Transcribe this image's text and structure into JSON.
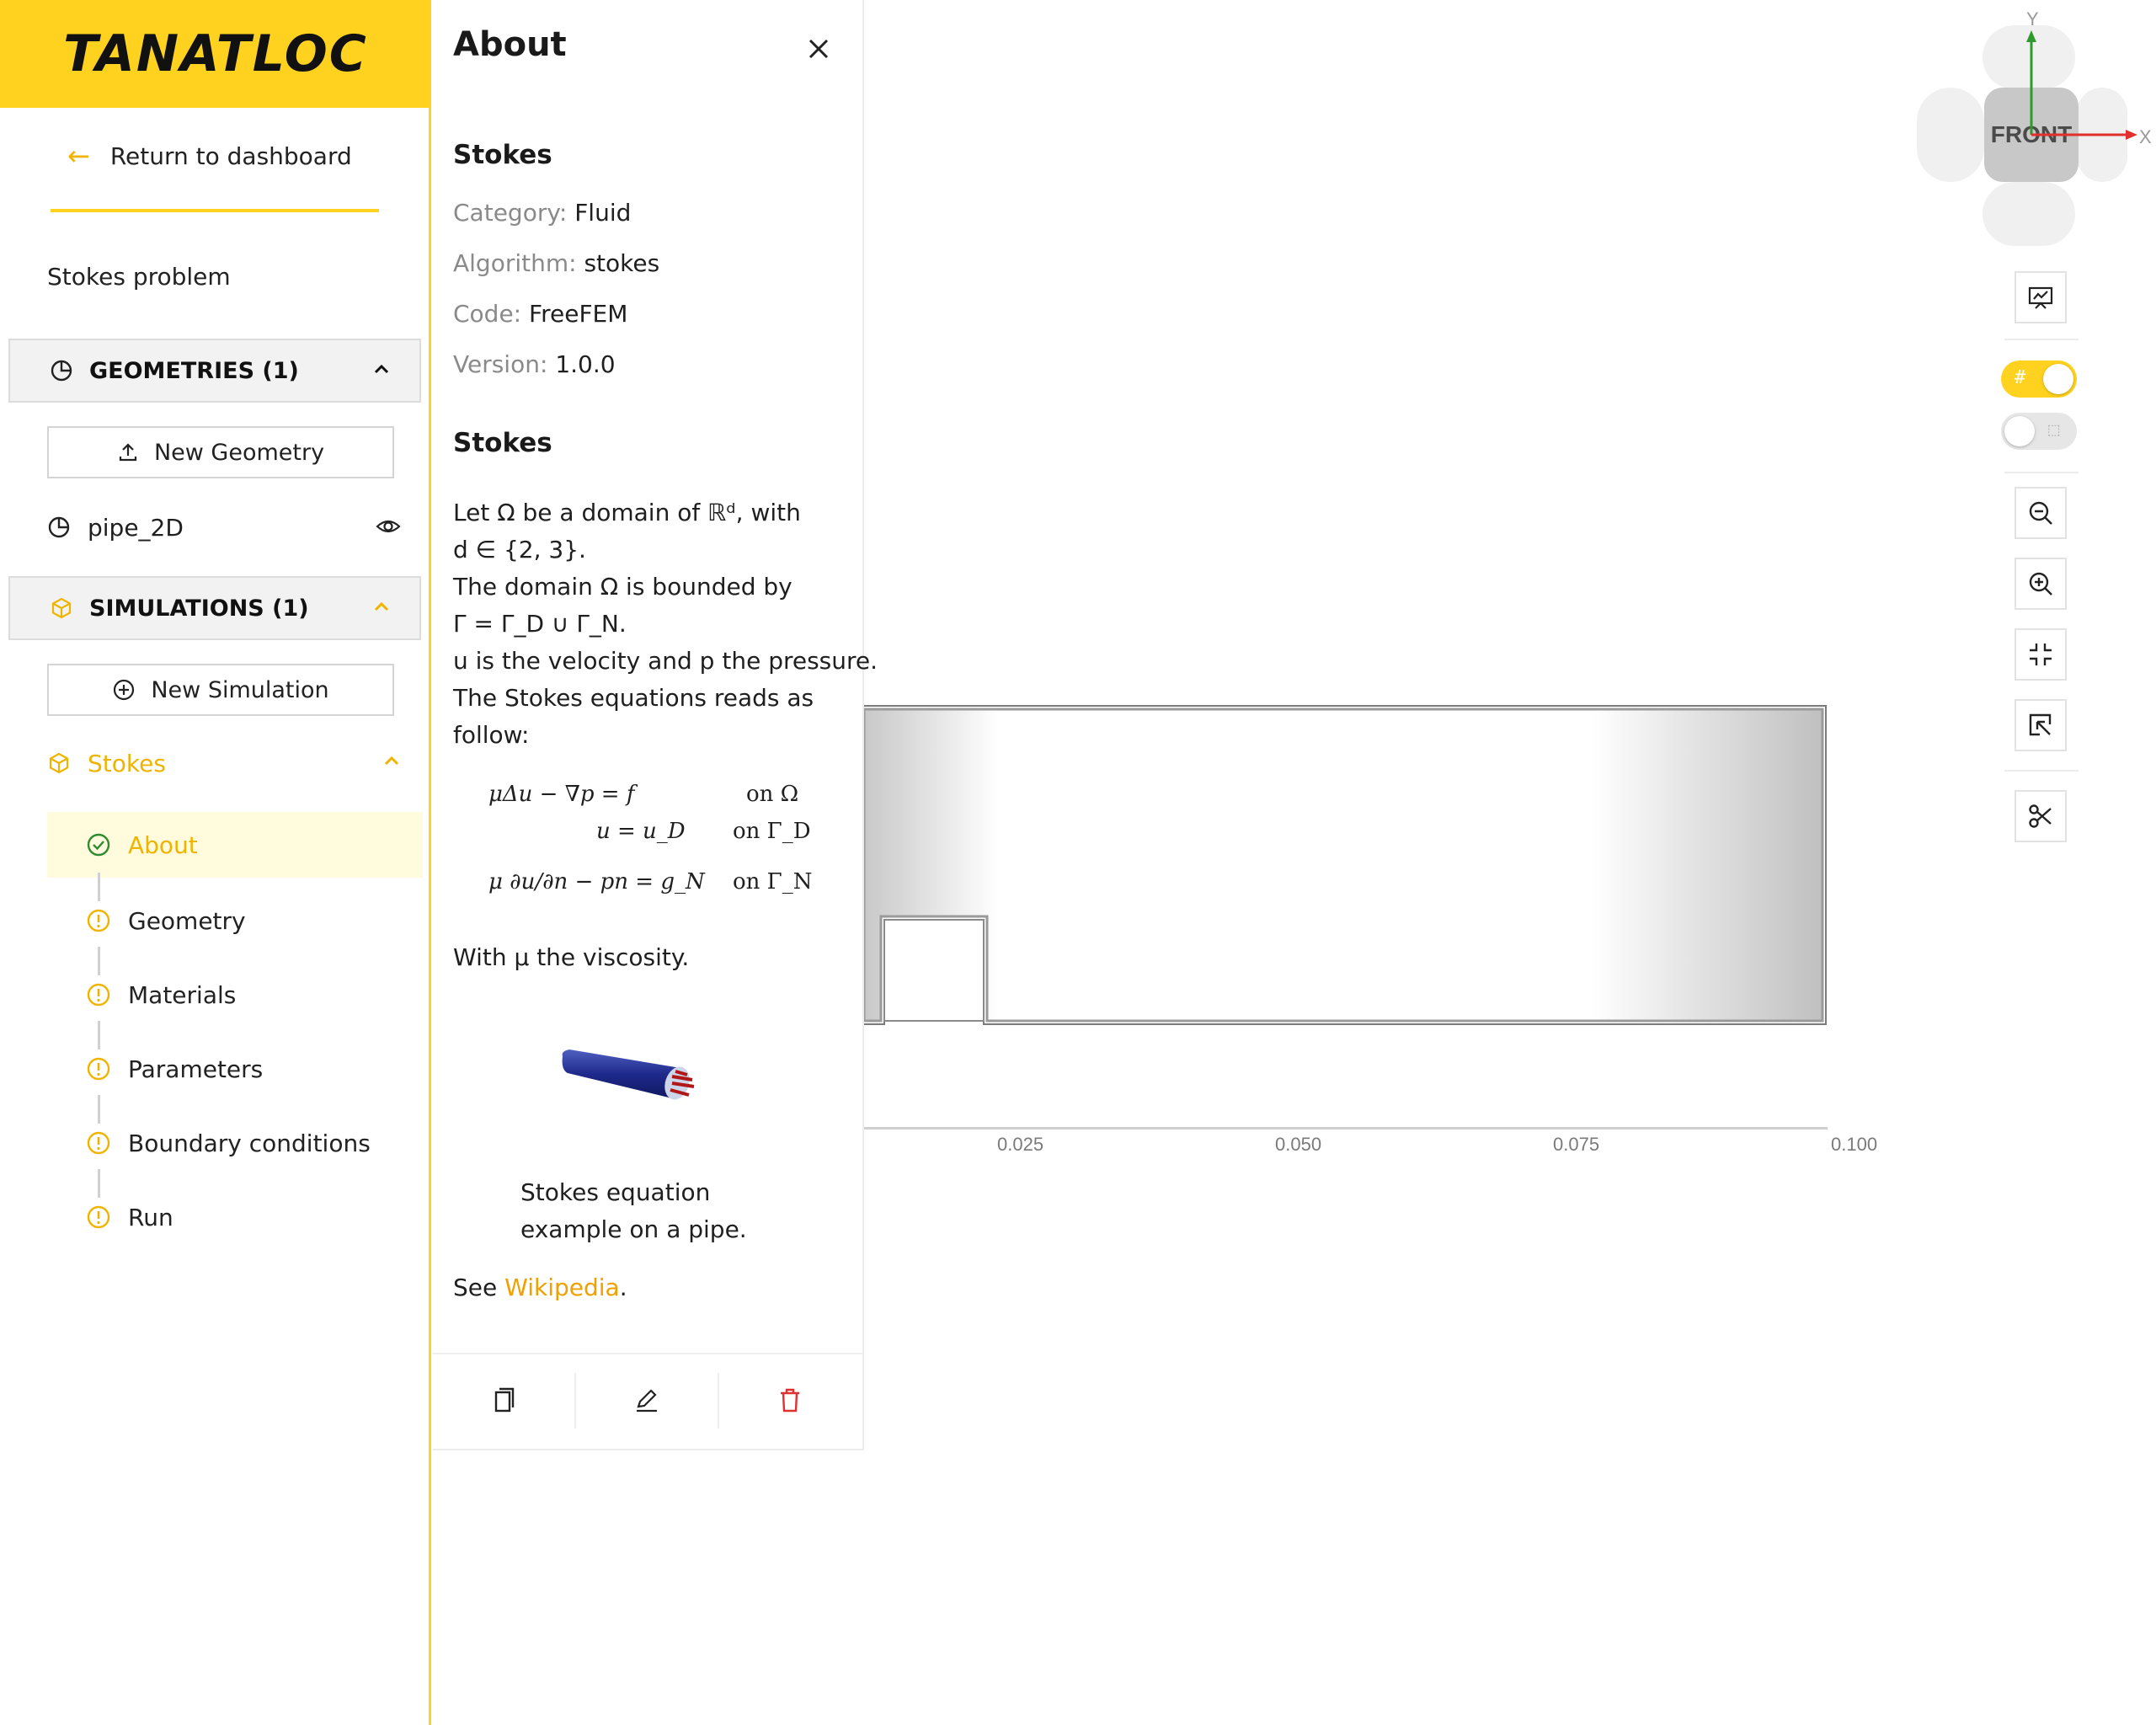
{
  "brand": {
    "logo_text": "TANATLOC",
    "accent_color": "#ffd21f",
    "link_color": "#f0a000"
  },
  "sidebar": {
    "return_label": "Return to dashboard",
    "project_name": "Stokes problem",
    "geometries": {
      "header": "GEOMETRIES (1)",
      "new_button": "New Geometry",
      "items": [
        {
          "label": "pipe_2D"
        }
      ]
    },
    "simulations": {
      "header": "SIMULATIONS (1)",
      "new_button": "New Simulation",
      "items": [
        {
          "label": "Stokes",
          "steps": [
            {
              "label": "About",
              "status": "done",
              "active": true
            },
            {
              "label": "Geometry",
              "status": "warning"
            },
            {
              "label": "Materials",
              "status": "warning"
            },
            {
              "label": "Parameters",
              "status": "warning"
            },
            {
              "label": "Boundary conditions",
              "status": "warning"
            },
            {
              "label": "Run",
              "status": "warning"
            }
          ]
        }
      ]
    }
  },
  "about_panel": {
    "title": "About",
    "info": {
      "title": "Stokes",
      "category_label": "Category:",
      "category": "Fluid",
      "algorithm_label": "Algorithm:",
      "algorithm": "stokes",
      "code_label": "Code:",
      "code": "FreeFEM",
      "version_label": "Version:",
      "version": "1.0.0"
    },
    "description": {
      "title": "Stokes",
      "lines": [
        "Let Ω be a domain of ℝᵈ, with",
        "d ∈ {2, 3}.",
        "The domain Ω is bounded by",
        "Γ = Γ_D ∪ Γ_N.",
        "u is the velocity and p the pressure.",
        "The Stokes equations reads as",
        "follow:"
      ],
      "equations": [
        {
          "lhs": "μΔu − ∇p = f",
          "rhs": "on Ω"
        },
        {
          "lhs": "u = u_D",
          "rhs": "on Γ_D"
        },
        {
          "lhs": "μ ∂u/∂n − pn = g_N",
          "rhs": "on Γ_N"
        }
      ],
      "viscosity_line": "With μ the viscosity.",
      "image_caption": "Stokes equation example on a pipe.",
      "see_prefix": "See",
      "see_link": "Wikipedia",
      "see_suffix": "."
    },
    "footer_actions": [
      "copy-icon",
      "edit-icon",
      "delete-icon"
    ]
  },
  "viewer": {
    "axis_ticks": [
      "0.025",
      "0.050",
      "0.075",
      "0.100"
    ],
    "view_cube": {
      "face": "FRONT",
      "axis_x": "X",
      "axis_y": "Y"
    },
    "toolbar": {
      "grid_toggle_on": true,
      "second_toggle_on": false,
      "buttons": [
        "screenshot-icon",
        "zoom-out-icon",
        "zoom-in-icon",
        "fit-icon",
        "zoom-to-selection-icon",
        "section-cut-icon"
      ]
    }
  }
}
